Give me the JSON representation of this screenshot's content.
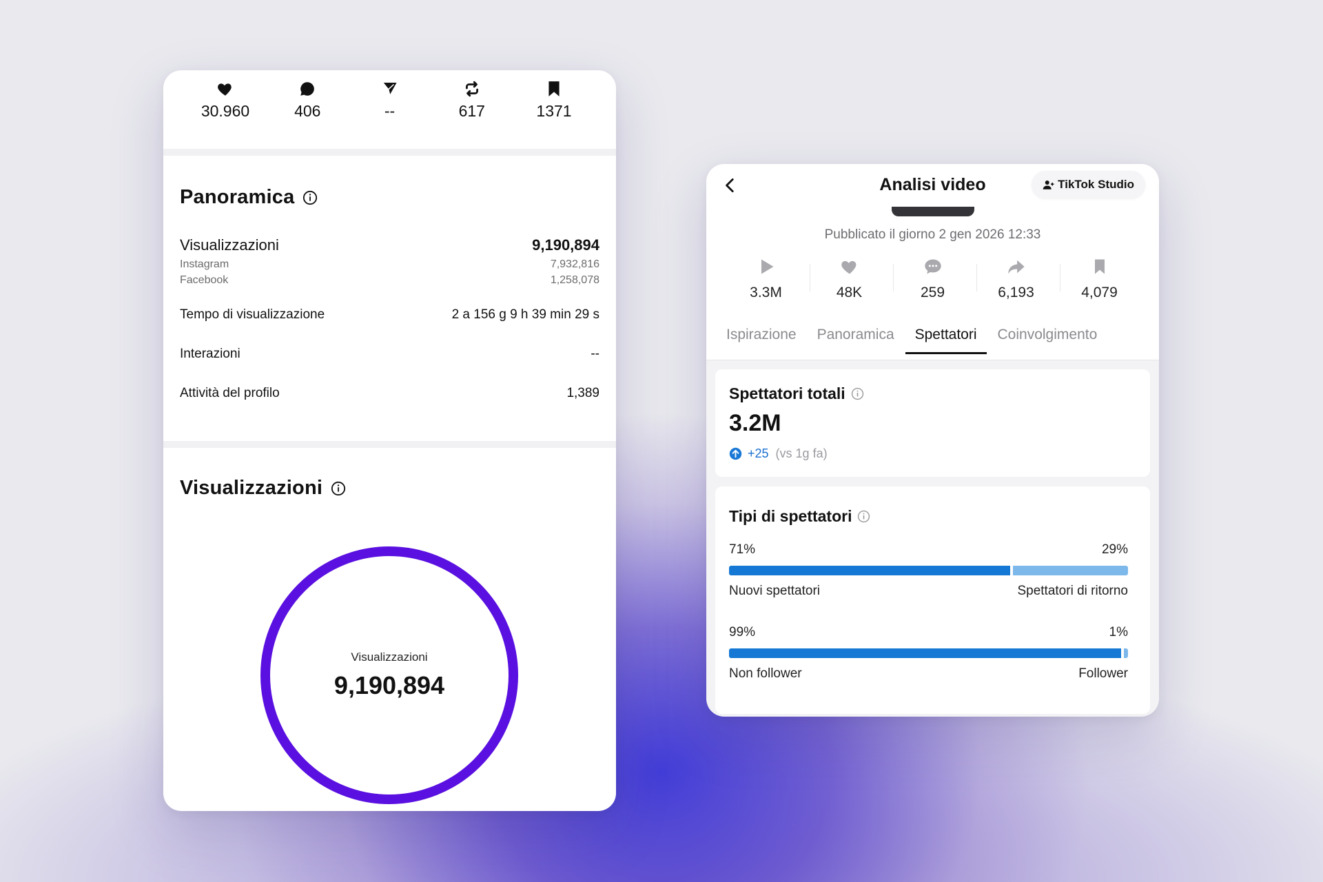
{
  "instagram": {
    "stats": [
      {
        "icon": "heart-icon",
        "value": "30.960"
      },
      {
        "icon": "comment-icon",
        "value": "406"
      },
      {
        "icon": "send-icon",
        "value": "--"
      },
      {
        "icon": "repost-icon",
        "value": "617"
      },
      {
        "icon": "bookmark-icon",
        "value": "1371"
      }
    ],
    "overview": {
      "title": "Panoramica",
      "views_label": "Visualizzazioni",
      "views_value": "9,190,894",
      "instagram_label": "Instagram",
      "instagram_value": "7,932,816",
      "facebook_label": "Facebook",
      "facebook_value": "1,258,078",
      "watch_time_label": "Tempo di visualizzazione",
      "watch_time_value": "2 a 156 g 9 h 39 min 29 s",
      "interactions_label": "Interazioni",
      "interactions_value": "--",
      "profile_activity_label": "Attività del profilo",
      "profile_activity_value": "1,389"
    },
    "views_section": {
      "title": "Visualizzazioni",
      "donut_label": "Visualizzazioni",
      "donut_value": "9,190,894",
      "ring_color": "#5a10e0"
    }
  },
  "tiktok": {
    "title": "Analisi video",
    "studio_button": "TikTok Studio",
    "published": "Pubblicato il giorno 2 gen 2026 12:33",
    "stats": [
      {
        "icon": "play-icon",
        "value": "3.3M"
      },
      {
        "icon": "heart-icon",
        "value": "48K"
      },
      {
        "icon": "comment-icon",
        "value": "259"
      },
      {
        "icon": "share-icon",
        "value": "6,193"
      },
      {
        "icon": "bookmark-icon",
        "value": "4,079"
      }
    ],
    "tabs": [
      "Ispirazione",
      "Panoramica",
      "Spettatori",
      "Coinvolgimento"
    ],
    "active_tab": "Spettatori",
    "total_viewers": {
      "title": "Spettatori totali",
      "value": "3.2M",
      "delta": "+25",
      "delta_note": "(vs 1g fa)"
    },
    "viewer_types": {
      "title": "Tipi di spettatori",
      "bars": [
        {
          "left_pct": "71%",
          "right_pct": "29%",
          "left_fraction": 0.71,
          "left_label": "Nuovi spettatori",
          "right_label": "Spettatori di ritorno"
        },
        {
          "left_pct": "99%",
          "right_pct": "1%",
          "left_fraction": 0.99,
          "left_label": "Non follower",
          "right_label": "Follower"
        }
      ],
      "primary_color": "#1478d4",
      "secondary_color": "#7cb8ea"
    }
  }
}
